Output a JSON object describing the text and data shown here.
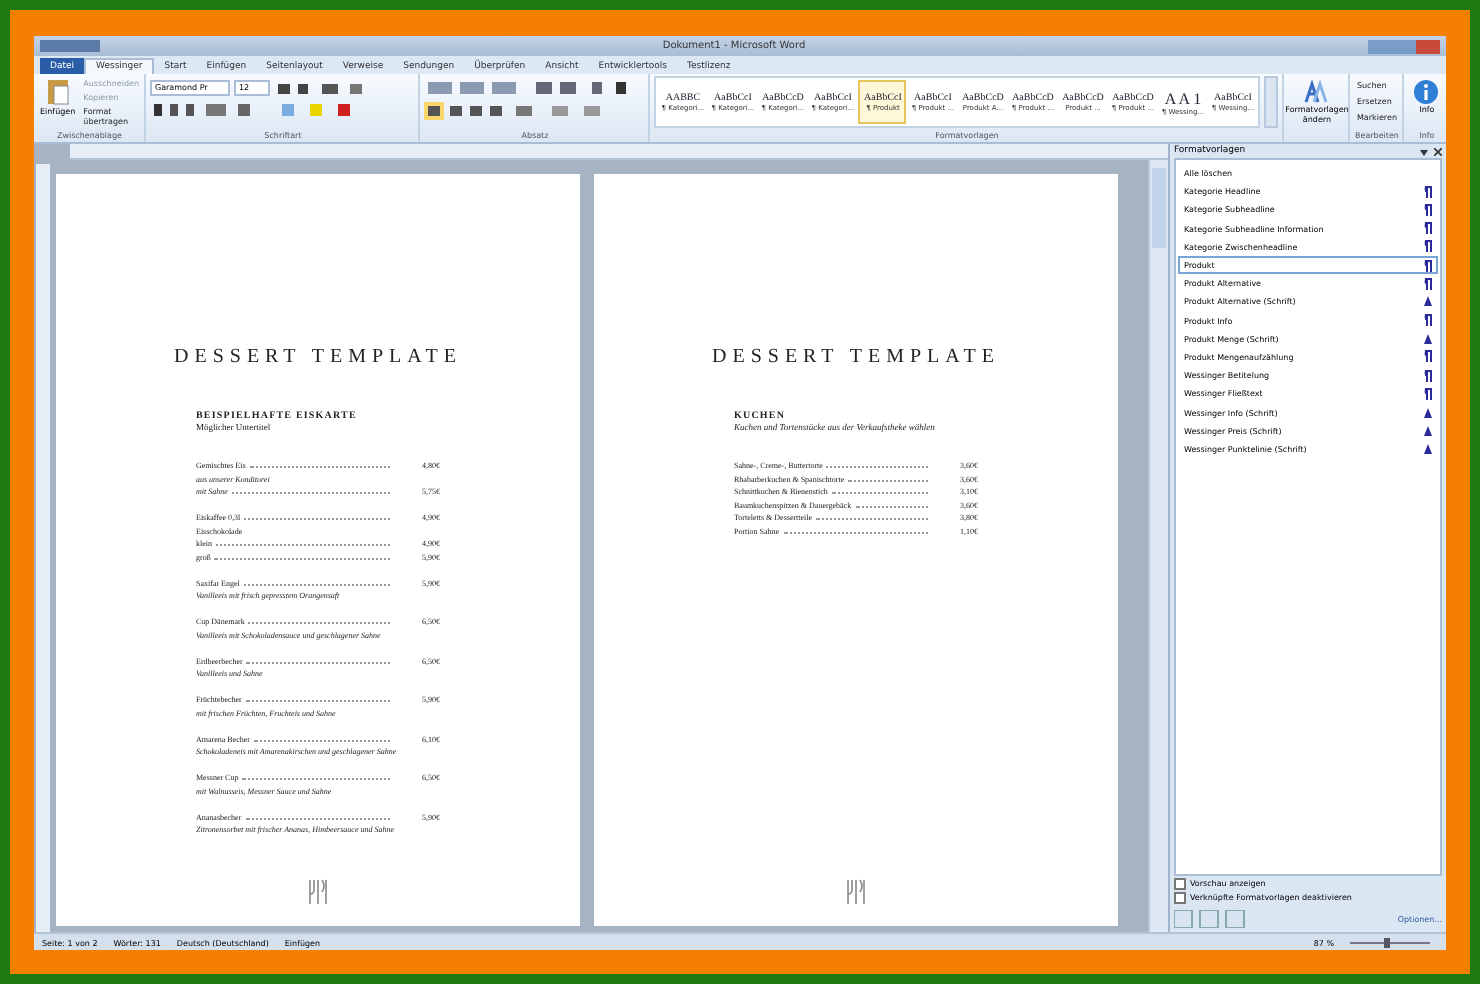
{
  "window": {
    "title": "Dokument1 - Microsoft Word"
  },
  "file_tab": "Datei",
  "tabs": [
    {
      "label": "Wessinger",
      "selected": true
    },
    {
      "label": "Start",
      "selected": false
    },
    {
      "label": "Einfügen",
      "selected": false
    },
    {
      "label": "Seitenlayout",
      "selected": false
    },
    {
      "label": "Verweise",
      "selected": false
    },
    {
      "label": "Sendungen",
      "selected": false
    },
    {
      "label": "Überprüfen",
      "selected": false
    },
    {
      "label": "Ansicht",
      "selected": false
    },
    {
      "label": "Entwicklertools",
      "selected": false
    },
    {
      "label": "Testlizenz",
      "selected": false
    }
  ],
  "clipboard": {
    "paste": "Einfügen",
    "actions": [
      "Ausschneiden",
      "Kopieren",
      "Format übertragen"
    ],
    "label": "Zwischenablage"
  },
  "font": {
    "family": "Garamond Pr",
    "size": "12",
    "label": "Schriftart"
  },
  "paragraph": {
    "label": "Absatz"
  },
  "styles_gallery": {
    "label": "Formatvorlagen",
    "items": [
      {
        "preview": "AABBC",
        "name": "¶ Kategori...",
        "selected": false
      },
      {
        "preview": "AaBbCcI",
        "name": "¶ Kategori...",
        "selected": false
      },
      {
        "preview": "AaBbCcD",
        "name": "¶ Kategori...",
        "selected": false
      },
      {
        "preview": "AaBbCcI",
        "name": "¶ Kategori...",
        "selected": false
      },
      {
        "preview": "AaBbCcI",
        "name": "¶ Produkt",
        "selected": true
      },
      {
        "preview": "AaBbCcI",
        "name": "¶ Produkt ...",
        "selected": false
      },
      {
        "preview": "AaBbCcD",
        "name": "Produkt A...",
        "selected": false
      },
      {
        "preview": "AaBbCcD",
        "name": "¶ Produkt ...",
        "selected": false
      },
      {
        "preview": "AaBbCcD",
        "name": "Produkt ...",
        "selected": false
      },
      {
        "preview": "AaBbCcD",
        "name": "¶ Produkt ...",
        "selected": false
      },
      {
        "preview": "A A 1",
        "name": "¶ Wessing...",
        "selected": false
      },
      {
        "preview": "AaBbCcI",
        "name": "¶ Wessing...",
        "selected": false
      }
    ],
    "change": "Formatvorlagen ändern"
  },
  "editing": {
    "actions": [
      "Suchen",
      "Ersetzen",
      "Markieren"
    ],
    "label": "Bearbeiten"
  },
  "info": {
    "button": "Info",
    "label": "Info"
  },
  "pages": [
    {
      "title": "DESSERT TEMPLATE",
      "heading": "BEISPIELHAFTE EISKARTE",
      "subtitle": "Möglicher Untertitel",
      "entries": [
        [
          {
            "text": "Gemischtes Eis",
            "italic": false,
            "price": "4,80€"
          },
          {
            "text": "aus unserer Konditorei",
            "italic": true
          },
          {
            "text": "mit Sahne",
            "italic": true,
            "price": "5,75€"
          }
        ],
        [
          {
            "text": "Eiskaffee 0,3l",
            "italic": false,
            "price": "4,90€"
          },
          {
            "text": "Eisschokolade",
            "italic": false
          },
          {
            "text": "klein",
            "italic": false,
            "price": "4,90€"
          },
          {
            "text": "groß",
            "italic": false,
            "price": "5,90€"
          }
        ],
        [
          {
            "text": "Saxifar Engel",
            "italic": false,
            "price": "5,90€"
          },
          {
            "text": "Vanilleeis mit frisch gepresstem Orangensaft",
            "italic": true
          }
        ],
        [
          {
            "text": "Cup Dänemark",
            "italic": false,
            "price": "6,50€"
          },
          {
            "text": "Vanilleeis mit Schokoladensauce und geschlagener Sahne",
            "italic": true
          }
        ],
        [
          {
            "text": "Erdbeerbecher",
            "italic": false,
            "price": "6,50€"
          },
          {
            "text": "Vanilleeis und Sahne",
            "italic": true
          }
        ],
        [
          {
            "text": "Früchtebecher",
            "italic": false,
            "price": "5,90€"
          },
          {
            "text": "mit frischen Früchten, Fruchteis und Sahne",
            "italic": true
          }
        ],
        [
          {
            "text": "Amarena Becher",
            "italic": false,
            "price": "6,10€"
          },
          {
            "text": "Schokoladeneis mit Amarenakirschen und geschlagener Sahne",
            "italic": true
          }
        ],
        [
          {
            "text": "Messner Cup",
            "italic": false,
            "price": "6,50€"
          },
          {
            "text": "mit Walnusseis, Messner Sauce und Sahne",
            "italic": true
          }
        ],
        [
          {
            "text": "Ananasbecher",
            "italic": false,
            "price": "5,90€"
          },
          {
            "text": "Zitronensorbet mit frischer Ananas, Himbeersauce und Sahne",
            "italic": true
          }
        ]
      ]
    },
    {
      "title": "DESSERT TEMPLATE",
      "heading": "KUCHEN",
      "subtitle": "Kuchen und Tortenstücke aus der Verkaufstheke wählen",
      "entries": [
        [
          {
            "text": "Sahne-, Creme-, Buttertorte",
            "italic": false,
            "price": "3,60€"
          },
          {
            "text": "Rhabarberkuchen & Spanischtorte",
            "italic": false,
            "price": "3,60€"
          },
          {
            "text": "Schnittkuchen & Bienenstich",
            "italic": false,
            "price": "3,10€"
          },
          {
            "text": "Baumkuchenspitzen & Dauergebäck",
            "italic": false,
            "price": "3,60€"
          },
          {
            "text": "Torteletts & Dessertteile",
            "italic": false,
            "price": "3,80€"
          },
          {
            "text": "Portion Sahne",
            "italic": false,
            "price": "1,10€"
          }
        ]
      ]
    }
  ],
  "styles_pane": {
    "title": "Formatvorlagen",
    "items": [
      {
        "name": "Alle löschen",
        "kind": "none",
        "selected": false
      },
      {
        "name": "Kategorie Headline",
        "kind": "paragraph",
        "selected": false
      },
      {
        "name": "Kategorie Subheadline",
        "kind": "paragraph",
        "selected": false
      },
      {
        "name": "Kategorie Subheadline Information",
        "kind": "paragraph",
        "selected": false
      },
      {
        "name": "Kategorie Zwischenheadline",
        "kind": "paragraph",
        "selected": false
      },
      {
        "name": "Produkt",
        "kind": "paragraph",
        "selected": true
      },
      {
        "name": "Produkt Alternative",
        "kind": "paragraph",
        "selected": false
      },
      {
        "name": "Produkt Alternative (Schrift)",
        "kind": "character",
        "selected": false
      },
      {
        "name": "Produkt Info",
        "kind": "paragraph",
        "selected": false
      },
      {
        "name": "Produkt Menge (Schrift)",
        "kind": "character",
        "selected": false
      },
      {
        "name": "Produkt Mengenaufzählung",
        "kind": "paragraph",
        "selected": false
      },
      {
        "name": "Wessinger Betitelung",
        "kind": "paragraph",
        "selected": false
      },
      {
        "name": "Wessinger Fließtext",
        "kind": "paragraph",
        "selected": false
      },
      {
        "name": "Wessinger Info (Schrift)",
        "kind": "character",
        "selected": false
      },
      {
        "name": "Wessinger Preis (Schrift)",
        "kind": "character",
        "selected": false
      },
      {
        "name": "Wessinger Punktelinie (Schrift)",
        "kind": "character",
        "selected": false
      }
    ],
    "options": [
      {
        "label": "Vorschau anzeigen",
        "checked": false
      },
      {
        "label": "Verknüpfte Formatvorlagen deaktivieren",
        "checked": false
      }
    ],
    "link": "Optionen..."
  },
  "status_bar": {
    "page": "Seite: 1 von 2",
    "words": "Wörter: 131",
    "language": "Deutsch (Deutschland)",
    "mode": "Einfügen",
    "zoom": "87 %",
    "zoom_slider": {
      "level": 0.45
    }
  }
}
